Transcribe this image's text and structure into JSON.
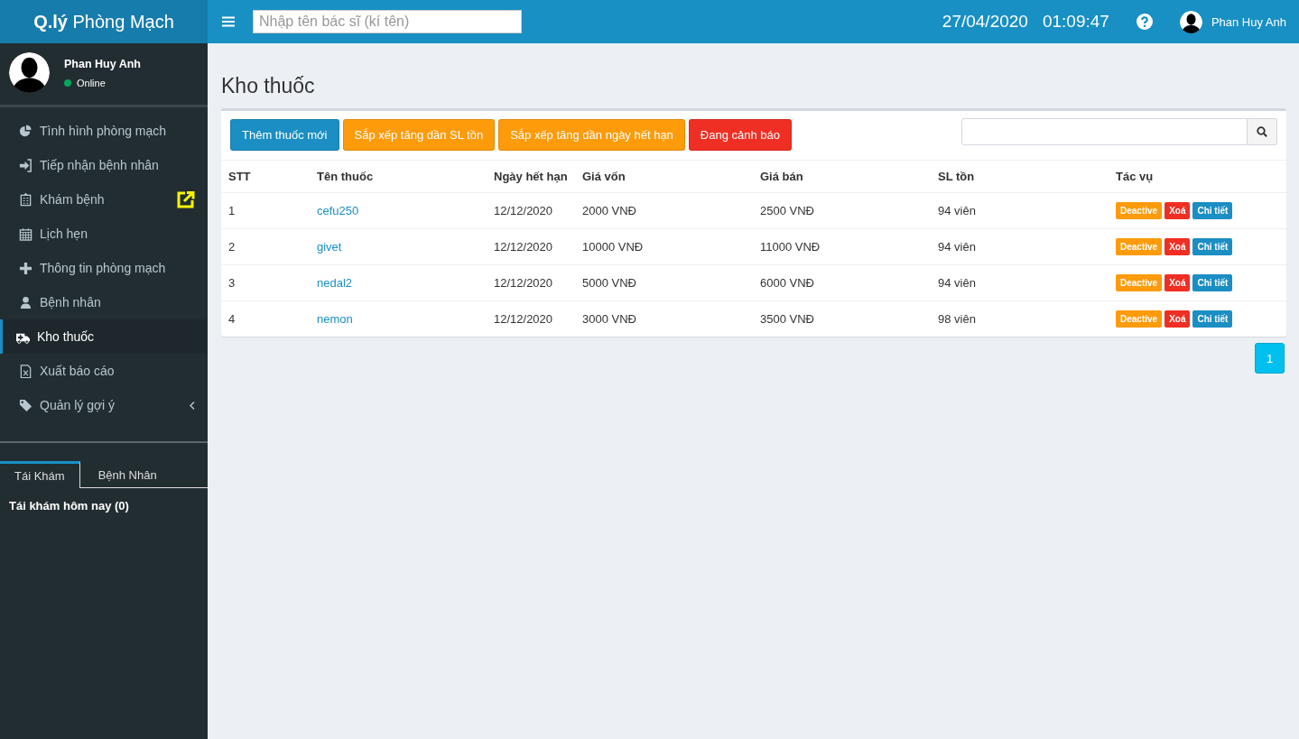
{
  "header": {
    "brand": "**Q.lý** Phòng Mạch",
    "search": {
      "placeholder": "Nhập tên bác sĩ (kí tên)"
    },
    "date": "27/04/2020",
    "time": "01:09:47",
    "user": "Phan Huy Anh"
  },
  "sidebar": {
    "user": {
      "name": "Phan Huy Anh",
      "status": "Online",
      "online": true
    },
    "items": [
      {
        "label": "Tình hình phòng mạch",
        "selected": false,
        "expandable": false
      },
      {
        "label": "Tiếp nhận bệnh nhân",
        "selected": false,
        "expandable": false
      },
      {
        "label": "Khám bệnh",
        "selected": false,
        "expandable": false
      },
      {
        "label": "Lịch hẹn",
        "selected": false,
        "expandable": false
      },
      {
        "label": "Thông tin phòng mạch",
        "selected": false,
        "expandable": false
      },
      {
        "label": "Bệnh nhân",
        "selected": false,
        "expandable": false
      },
      {
        "label": "Kho thuốc",
        "selected": true,
        "expandable": false
      },
      {
        "label": "Xuất báo cáo",
        "selected": false,
        "expandable": false
      },
      {
        "label": "Quản lý gợi ý",
        "selected": false,
        "expandable": true
      }
    ],
    "tabs": [
      {
        "label": "Tái Khám",
        "selected": true
      },
      {
        "label": "Bệnh Nhân",
        "selected": false
      }
    ],
    "tab_content": "Tái khám hôm nay (0)"
  },
  "page": {
    "title": "Kho thuốc",
    "buttons": [
      {
        "label": "Thêm thuốc mới",
        "kind": "primary"
      },
      {
        "label": "Sắp xếp tăng dần SL tồn",
        "kind": "warning"
      },
      {
        "label": "Sắp xếp tăng dần ngày hết hạn",
        "kind": "warning"
      },
      {
        "label": "Đang cảnh báo",
        "kind": "danger"
      }
    ],
    "table": {
      "columns": [
        "STT",
        "Tên thuốc",
        "Ngày hết hạn",
        "Giá vốn",
        "Giá bán",
        "SL tồn",
        "Tác vụ"
      ],
      "rows": [
        {
          "stt": "1",
          "name": "cefu250",
          "expiry": "12/12/2020",
          "cost": "2000 VNĐ",
          "price": "2500 VNĐ",
          "stock": "94 viên",
          "actions": [
            {
              "label": "Deactive",
              "kind": "warning"
            },
            {
              "label": "Xoá",
              "kind": "danger"
            },
            {
              "label": "Chi tiết",
              "kind": "primary"
            }
          ]
        },
        {
          "stt": "2",
          "name": "givet",
          "expiry": "12/12/2020",
          "cost": "10000 VNĐ",
          "price": "11000 VNĐ",
          "stock": "94 viên",
          "actions": [
            {
              "label": "Deactive",
              "kind": "warning"
            },
            {
              "label": "Xoá",
              "kind": "danger"
            },
            {
              "label": "Chi tiết",
              "kind": "primary"
            }
          ]
        },
        {
          "stt": "3",
          "name": "nedal2",
          "expiry": "12/12/2020",
          "cost": "5000 VNĐ",
          "price": "6000 VNĐ",
          "stock": "94 viên",
          "actions": [
            {
              "label": "Deactive",
              "kind": "warning"
            },
            {
              "label": "Xoá",
              "kind": "danger"
            },
            {
              "label": "Chi tiết",
              "kind": "primary"
            }
          ]
        },
        {
          "stt": "4",
          "name": "nemon",
          "expiry": "12/12/2020",
          "cost": "3000 VNĐ",
          "price": "3500 VNĐ",
          "stock": "98 viên",
          "actions": [
            {
              "label": "Deactive",
              "kind": "warning"
            },
            {
              "label": "Xoá",
              "kind": "danger"
            },
            {
              "label": "Chi tiết",
              "kind": "primary"
            }
          ]
        }
      ]
    },
    "pagination": [
      {
        "label": "1",
        "selected": true
      }
    ]
  }
}
